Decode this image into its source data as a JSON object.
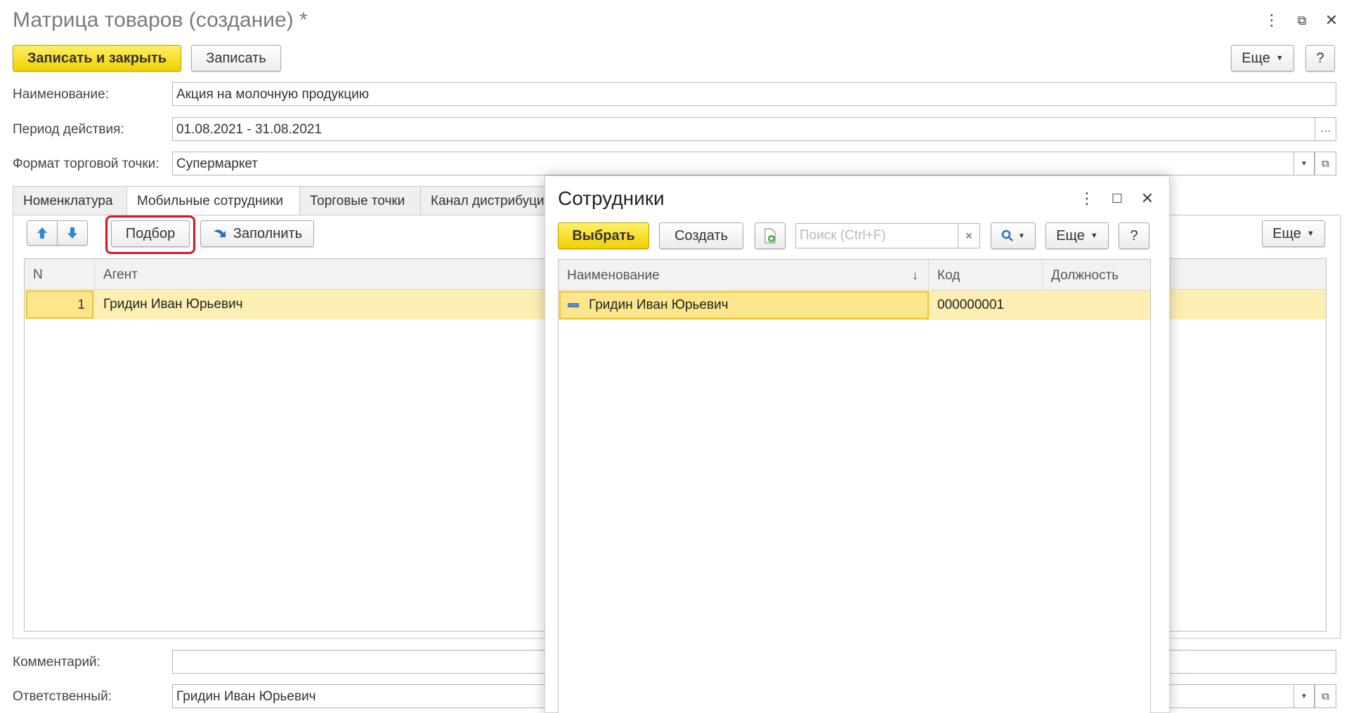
{
  "window": {
    "title": "Матрица товаров (создание) *",
    "controls": {
      "more": "⋮",
      "restore": "⧉",
      "close": "✕"
    }
  },
  "toolbar": {
    "save_close_label": "Записать и закрыть",
    "save_label": "Записать",
    "more_label": "Еще",
    "help_label": "?"
  },
  "form": {
    "name_label": "Наименование:",
    "name_value": "Акция на молочную продукцию",
    "period_label": "Период действия:",
    "period_value": "01.08.2021 - 31.08.2021",
    "format_label": "Формат торговой точки:",
    "format_value": "Супермаркет",
    "comment_label": "Комментарий:",
    "comment_value": "",
    "responsible_label": "Ответственный:",
    "responsible_value": "Гридин Иван Юрьевич"
  },
  "tabs": [
    {
      "label": "Номенклатура"
    },
    {
      "label": "Мобильные сотрудники"
    },
    {
      "label": "Торговые точки"
    },
    {
      "label": "Канал дистрибуции"
    }
  ],
  "tab_toolbar": {
    "pick_label": "Подбор",
    "fill_label": "Заполнить",
    "more_label": "Еще"
  },
  "main_table": {
    "columns": [
      "N",
      "Агент"
    ],
    "rows": [
      {
        "n": "1",
        "agent": "Гридин Иван Юрьевич"
      }
    ]
  },
  "dialog": {
    "title": "Сотрудники",
    "select_label": "Выбрать",
    "create_label": "Создать",
    "search_placeholder": "Поиск (Ctrl+F)",
    "search_clear": "×",
    "more_label": "Еще",
    "help_label": "?",
    "columns": [
      "Наименование",
      "Код",
      "Должность"
    ],
    "sort_indicator": "↓",
    "rows": [
      {
        "name": "Гридин Иван Юрьевич",
        "code": "000000001",
        "position": ""
      }
    ]
  },
  "colors": {
    "accent_yellow": "#f2d000",
    "row_highlight": "#fdefb4",
    "selected_cell": "#fce68c",
    "callout_red": "#e0141e"
  }
}
